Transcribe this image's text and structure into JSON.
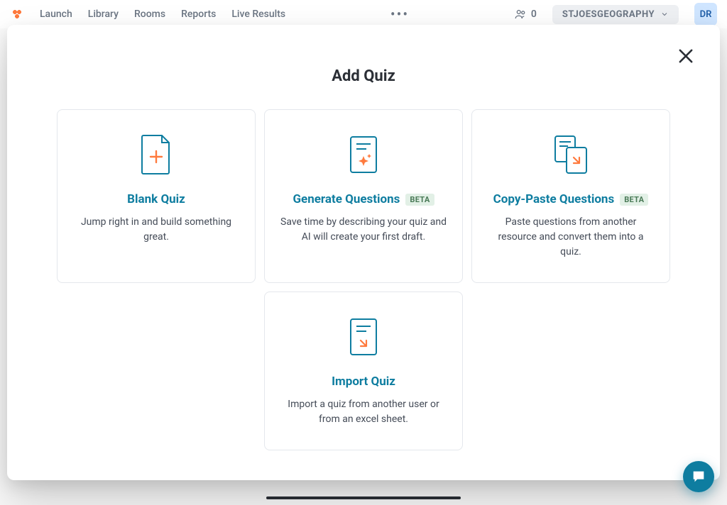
{
  "nav": {
    "launch": "Launch",
    "library": "Library",
    "rooms": "Rooms",
    "reports": "Reports",
    "live_results": "Live Results"
  },
  "topbar": {
    "participant_count": "0",
    "room_name": "STJOESGEOGRAPHY",
    "user_initials": "DR"
  },
  "modal": {
    "title": "Add Quiz",
    "beta_label": "BETA",
    "options": {
      "blank": {
        "title": "Blank Quiz",
        "desc": "Jump right in and build something great."
      },
      "generate": {
        "title": "Generate Questions",
        "desc": "Save time by describing your quiz and AI will create your first draft."
      },
      "paste": {
        "title": "Copy-Paste Questions",
        "desc": "Paste questions from another resource and convert them into a quiz."
      },
      "import": {
        "title": "Import Quiz",
        "desc": "Import a quiz from another user or from an excel sheet."
      }
    }
  }
}
